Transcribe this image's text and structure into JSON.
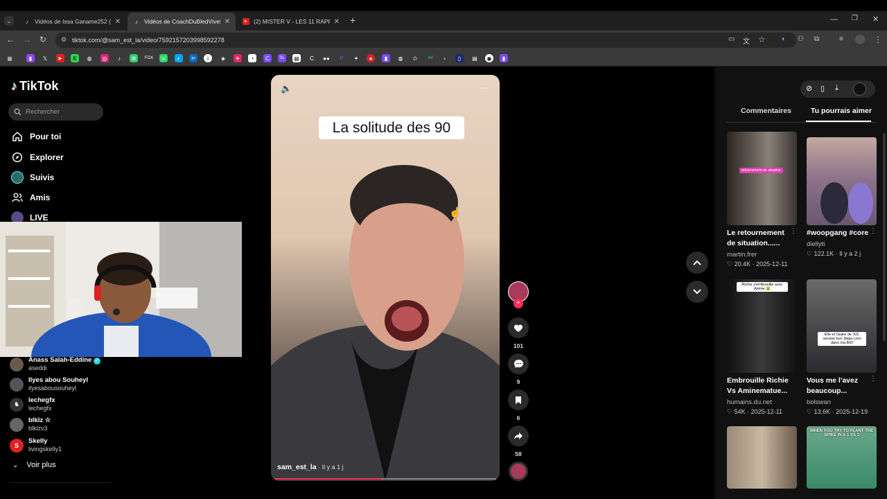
{
  "browser": {
    "tabs": [
      {
        "title": "Vidéos de Issa Ganame252 (@i",
        "active": false
      },
      {
        "title": "Vidéos de CoachDuBledViveLe",
        "active": true
      },
      {
        "title": "(2) MISTER V - LES 11 RAPPEUR",
        "active": false
      }
    ],
    "url": "tiktok.com/@sam_est_la/video/7592157203998592278"
  },
  "sidebar": {
    "logo": "TikTok",
    "search_placeholder": "Rechercher",
    "nav": [
      {
        "label": "Pour toi",
        "icon": "home-icon"
      },
      {
        "label": "Explorer",
        "icon": "compass-icon"
      },
      {
        "label": "Suivis",
        "icon": "following-icon"
      },
      {
        "label": "Amis",
        "icon": "friends-icon"
      },
      {
        "label": "LIVE",
        "icon": "live-icon"
      }
    ],
    "following": [
      {
        "name": "Anass Salah-Eddine",
        "handle": "aseddi",
        "verified": true
      },
      {
        "name": "Ilyes abou Souheyl",
        "handle": "ilyesabousouheyl"
      },
      {
        "name": "lechegfx",
        "handle": "lechegfx"
      },
      {
        "name": "blklz ☆",
        "handle": "blklzv3"
      },
      {
        "name": "Skelly",
        "handle": "livingskelly1"
      }
    ],
    "see_more": "Voir plus"
  },
  "video": {
    "caption_overlay": "La solitude des 90",
    "author": "sam_est_la",
    "time": " · Il y a 1 j",
    "progress": 0.48
  },
  "actions": {
    "likes": "101",
    "comments": "9",
    "saves": "6",
    "shares": "58"
  },
  "right_panel": {
    "tabs": [
      "Commentaires",
      "Tu pourrais aimer"
    ],
    "active_tab": 1,
    "cards": [
      {
        "title1": "Le retournement",
        "title2": "de situation......",
        "author": "martin.frer",
        "likes": "20.4K",
        "date": " · 2025-12-11",
        "thumb_text": "retournement de situation"
      },
      {
        "title1": "#woopgang #core",
        "title2": "",
        "author": "diellyti",
        "likes": "122.1K",
        "date": " · Il y a 2 j",
        "thumb_text": ""
      },
      {
        "title1": "Embrouille Richie",
        "title2": "Vs Aminematue...",
        "author": "humains.du.net",
        "likes": "54K",
        "date": " · 2025-12-11",
        "thumb_text": "Richie s'embrouille avec Amine 😅"
      },
      {
        "title1": "Vous me l'avez",
        "title2": "beaucoup...",
        "author": "bolswan",
        "likes": "13.6K",
        "date": " · 2025-12-19",
        "thumb_text": "Elle et l'autre de JUL version turc dispo Lien dans ma BIO"
      },
      {
        "title1": "",
        "title2": "",
        "author": "",
        "likes": "",
        "date": "",
        "thumb_text": ""
      },
      {
        "title1": "",
        "title2": "",
        "author": "",
        "likes": "",
        "date": "",
        "thumb_text": "WHEN YOU TRY TO PLANT THE SPIKE IN A 1 VS 1"
      }
    ]
  }
}
